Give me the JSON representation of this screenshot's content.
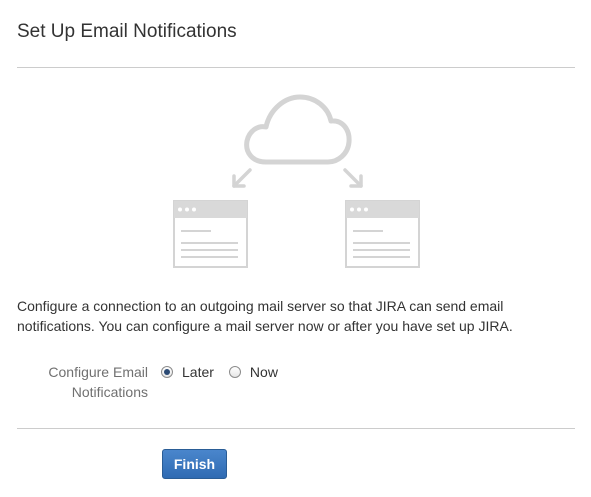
{
  "page": {
    "title": "Set Up Email Notifications",
    "description": "Configure a connection to an outgoing mail server so that JIRA can send email notifications. You can configure a mail server now or after you have set up JIRA."
  },
  "form": {
    "field_label": "Configure Email Notifications",
    "options": [
      {
        "label": "Later",
        "selected": true
      },
      {
        "label": "Now",
        "selected": false
      }
    ]
  },
  "actions": {
    "finish_label": "Finish"
  },
  "illustration": {
    "icons": [
      "cloud-icon",
      "arrow-down-left-icon",
      "arrow-down-right-icon",
      "browser-window-icon",
      "browser-window-icon"
    ],
    "stroke_color": "#d4d4d4",
    "bar_color": "#d9d9d9"
  },
  "colors": {
    "button_bg": "#3572b0",
    "radio_selected": "#2b4a74",
    "divider": "#cccccc"
  }
}
